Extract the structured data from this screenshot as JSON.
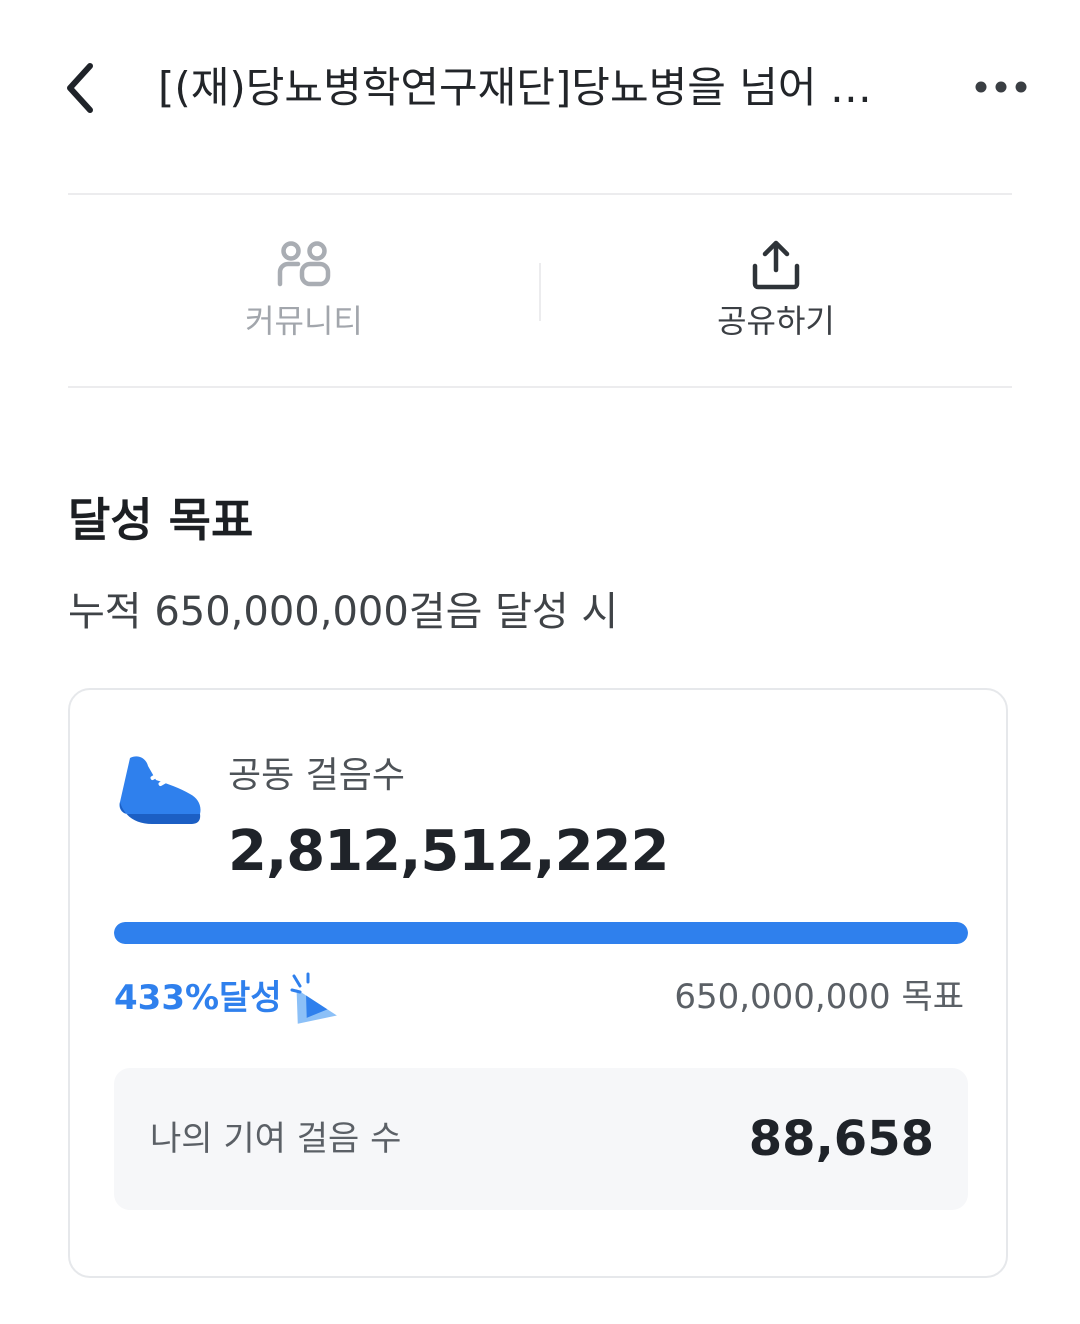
{
  "header": {
    "title": "[(재)당뇨병학연구재단]당뇨병을 넘어 …",
    "back_icon": "chevron-left-icon",
    "more_icon": "more-horizontal-icon"
  },
  "actions": {
    "community": {
      "label": "커뮤니티",
      "icon": "community-icon"
    },
    "share": {
      "label": "공유하기",
      "icon": "share-icon"
    }
  },
  "goal": {
    "title": "달성 목표",
    "subtitle": "누적 650,000,000걸음 달성 시"
  },
  "card": {
    "shared_steps_label": "공동 걸음수",
    "shared_steps_value": "2,812,512,222",
    "progress_fraction": 1.0,
    "achieved_text": "433%달성",
    "goal_text": "650,000,000 목표",
    "my_contribution_label": "나의 기여 걸음 수",
    "my_contribution_value": "88,658"
  },
  "colors": {
    "accent": "#2f80ed",
    "text_primary": "#1f2329",
    "text_secondary": "#5b6066",
    "divider": "#ececee",
    "community_icon": "#a9adb3",
    "community_label": "#a2a6ac",
    "share_icon": "#2e3338",
    "share_label": "#3b3f44"
  }
}
